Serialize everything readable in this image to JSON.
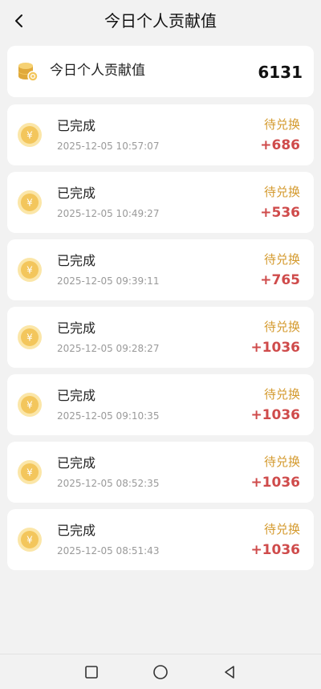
{
  "header": {
    "title": "今日个人贡献值",
    "back_icon": "chevron-left-icon"
  },
  "summary": {
    "label": "今日个人贡献值",
    "value": "6131",
    "icon": "coin-stack-icon"
  },
  "records": [
    {
      "status": "已完成",
      "time": "2025-12-05 10:57:07",
      "badge": "待兑换",
      "amount": "+686"
    },
    {
      "status": "已完成",
      "time": "2025-12-05 10:49:27",
      "badge": "待兑换",
      "amount": "+536"
    },
    {
      "status": "已完成",
      "time": "2025-12-05 09:39:11",
      "badge": "待兑换",
      "amount": "+765"
    },
    {
      "status": "已完成",
      "time": "2025-12-05 09:28:27",
      "badge": "待兑换",
      "amount": "+1036"
    },
    {
      "status": "已完成",
      "time": "2025-12-05 09:10:35",
      "badge": "待兑换",
      "amount": "+1036"
    },
    {
      "status": "已完成",
      "time": "2025-12-05 08:52:35",
      "badge": "待兑换",
      "amount": "+1036"
    },
    {
      "status": "已完成",
      "time": "2025-12-05 08:51:43",
      "badge": "待兑换",
      "amount": "+1036"
    }
  ],
  "colors": {
    "badge": "#d49a2e",
    "amount": "#cf4b4b",
    "coin": "#f3c65c"
  },
  "nav": {
    "recent_icon": "square-icon",
    "home_icon": "circle-icon",
    "back_icon": "triangle-back-icon"
  }
}
